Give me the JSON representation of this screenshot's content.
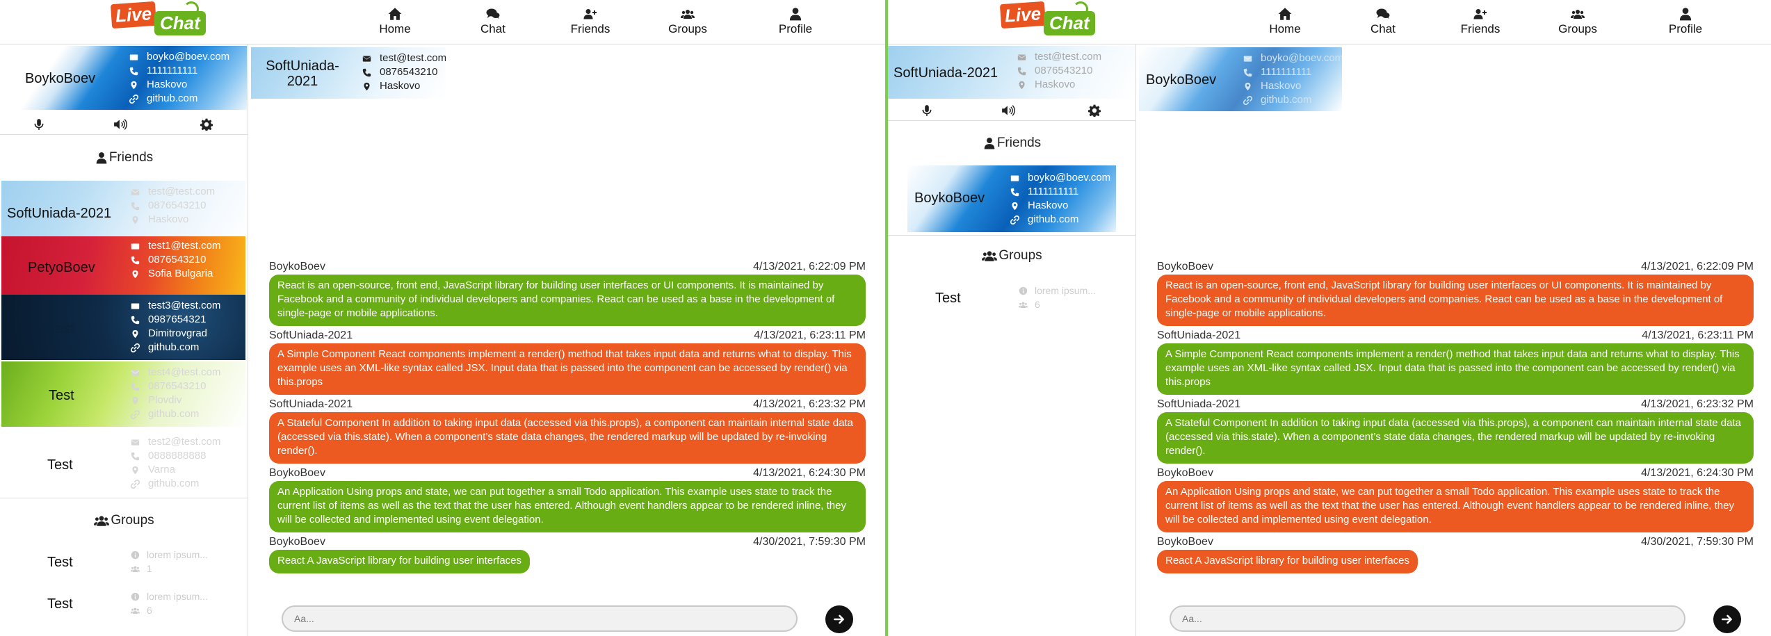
{
  "logo": {
    "live": "Live",
    "chat": "Chat"
  },
  "nav": [
    {
      "label": "Home",
      "icon": "home-icon"
    },
    {
      "label": "Chat",
      "icon": "chat-icon"
    },
    {
      "label": "Friends",
      "icon": "user-plus-icon"
    },
    {
      "label": "Groups",
      "icon": "users-icon"
    },
    {
      "label": "Profile",
      "icon": "user-icon"
    }
  ],
  "colors": {
    "green": "#67ad13",
    "orange": "#ec5a22",
    "divider": "#7bd04b"
  },
  "left": {
    "me": {
      "name": "BoykoBoev",
      "email": "boyko@boev.com",
      "phone": "1111111111",
      "city": "Haskovo",
      "link": "github.com"
    },
    "friends_title": "Friends",
    "friends": [
      {
        "name": "SoftUniada-2021",
        "email": "test@test.com",
        "phone": "0876543210",
        "city": "Haskovo"
      },
      {
        "name": "PetyoBoev",
        "email": "test1@test.com",
        "phone": "0876543210",
        "city": "Sofia Bulgaria"
      },
      {
        "name": "Test",
        "email": "test3@test.com",
        "phone": "0987654321",
        "city": "Dimitrovgrad",
        "link": "github.com"
      },
      {
        "name": "Test",
        "email": "test4@test.com",
        "phone": "0876543210",
        "city": "Plovdiv",
        "link": "github.com"
      },
      {
        "name": "Test",
        "email": "test2@test.com",
        "phone": "0888888888",
        "city": "Varna",
        "link": "github.com"
      }
    ],
    "groups_title": "Groups",
    "groups": [
      {
        "name": "Test",
        "desc": "lorem ipsum...",
        "count": "1"
      },
      {
        "name": "Test",
        "desc": "lorem ipsum...",
        "count": "6"
      }
    ],
    "chat_header": {
      "name": "SoftUniada-2021",
      "email": "test@test.com",
      "phone": "0876543210",
      "city": "Haskovo"
    },
    "messages": [
      {
        "sender": "BoykoBoev",
        "time": "4/13/2021, 6:22:09 PM",
        "text": "React is an open-source, front end, JavaScript library for building user interfaces or UI components. It is maintained by Facebook and a community of individual developers and companies. React can be used as a base in the development of single-page or mobile applications."
      },
      {
        "sender": "SoftUniada-2021",
        "time": "4/13/2021, 6:23:11 PM",
        "text": "A Simple Component React components implement a render() method that takes input data and returns what to display. This example uses an XML-like syntax called JSX. Input data that is passed into the component can be accessed by render() via this.props"
      },
      {
        "sender": "SoftUniada-2021",
        "time": "4/13/2021, 6:23:32 PM",
        "text": "A Stateful Component In addition to taking input data (accessed via this.props), a component can maintain internal state data (accessed via this.state). When a component’s state data changes, the rendered markup will be updated by re-invoking render()."
      },
      {
        "sender": "BoykoBoev",
        "time": "4/13/2021, 6:24:30 PM",
        "text": "An Application Using props and state, we can put together a small Todo application. This example uses state to track the current list of items as well as the text that the user has entered. Although event handlers appear to be rendered inline, they will be collected and implemented using event delegation."
      },
      {
        "sender": "BoykoBoev",
        "time": "4/30/2021, 7:59:30 PM",
        "text": "React A JavaScript library for building user interfaces"
      }
    ],
    "input_placeholder": "Aa..."
  },
  "right": {
    "me": {
      "name": "SoftUniada-2021",
      "email": "test@test.com",
      "phone": "0876543210",
      "city": "Haskovo"
    },
    "friends_title": "Friends",
    "friends": [
      {
        "name": "BoykoBoev",
        "email": "boyko@boev.com",
        "phone": "1111111111",
        "city": "Haskovo",
        "link": "github.com"
      }
    ],
    "groups_title": "Groups",
    "groups": [
      {
        "name": "Test",
        "desc": "lorem ipsum...",
        "count": "6"
      }
    ],
    "chat_header": {
      "name": "BoykoBoev",
      "email": "boyko@boev.com",
      "phone": "1111111111",
      "city": "Haskovo",
      "link": "github.com"
    },
    "messages": [
      {
        "sender": "BoykoBoev",
        "time": "4/13/2021, 6:22:09 PM",
        "text": "React is an open-source, front end, JavaScript library for building user interfaces or UI components. It is maintained by Facebook and a community of individual developers and companies. React can be used as a base in the development of single-page or mobile applications."
      },
      {
        "sender": "SoftUniada-2021",
        "time": "4/13/2021, 6:23:11 PM",
        "text": "A Simple Component React components implement a render() method that takes input data and returns what to display. This example uses an XML-like syntax called JSX. Input data that is passed into the component can be accessed by render() via this.props"
      },
      {
        "sender": "SoftUniada-2021",
        "time": "4/13/2021, 6:23:32 PM",
        "text": "A Stateful Component In addition to taking input data (accessed via this.props), a component can maintain internal state data (accessed via this.state). When a component’s state data changes, the rendered markup will be updated by re-invoking render()."
      },
      {
        "sender": "BoykoBoev",
        "time": "4/13/2021, 6:24:30 PM",
        "text": "An Application Using props and state, we can put together a small Todo application. This example uses state to track the current list of items as well as the text that the user has entered. Although event handlers appear to be rendered inline, they will be collected and implemented using event delegation."
      },
      {
        "sender": "BoykoBoev",
        "time": "4/30/2021, 7:59:30 PM",
        "text": "React A JavaScript library for building user interfaces"
      }
    ],
    "input_placeholder": "Aa..."
  }
}
